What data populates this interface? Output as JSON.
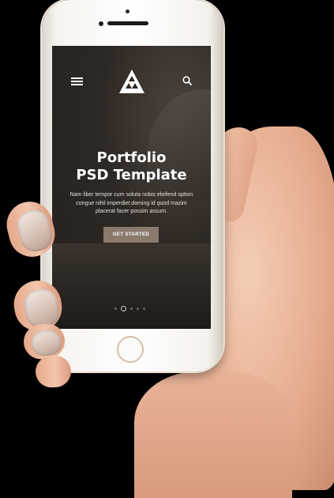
{
  "screen": {
    "title_line1": "Portfolio",
    "title_line2": "PSD Template",
    "body": "Nam liber tempor cum soluta nobis eleifend option congue nihil imperdiet doming id quod mazim placerat facer possim assum.",
    "cta_label": "GET STARTED"
  },
  "icons": {
    "menu": "hamburger-menu-icon",
    "logo": "triangle-logo-icon",
    "search": "search-icon"
  },
  "carousel": {
    "count": 5,
    "active_index": 1
  },
  "colors": {
    "screen_bg": "#2e2824",
    "cta_bg": "#8a7a6c",
    "text": "#ffffff"
  }
}
